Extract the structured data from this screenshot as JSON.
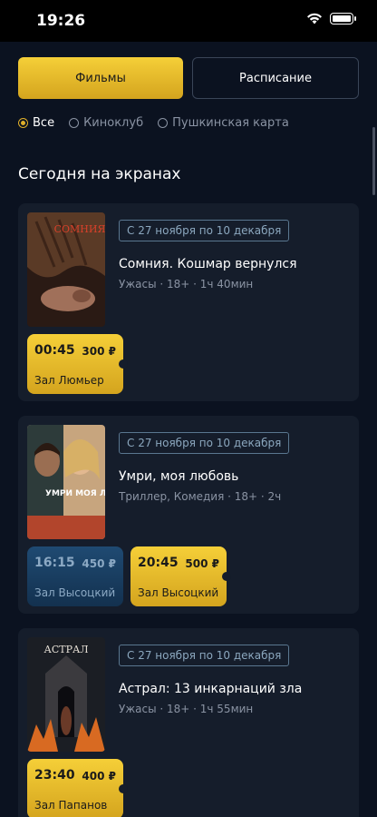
{
  "status_bar": {
    "time": "19:26"
  },
  "tabs": [
    {
      "label": "Фильмы",
      "active": true
    },
    {
      "label": "Расписание",
      "active": false
    }
  ],
  "filters": [
    {
      "label": "Все",
      "selected": true
    },
    {
      "label": "Киноклуб",
      "selected": false
    },
    {
      "label": "Пушкинская карта",
      "selected": false
    }
  ],
  "section_title": "Сегодня на экранах",
  "movies": [
    {
      "date_range": "С 27 ноября по 10 декабря",
      "title": "Сомния. Кошмар вернулся",
      "meta": "Ужасы · 18+ · 1ч 40мин",
      "poster_text": "СОМНИЯ",
      "sessions": [
        {
          "time": "00:45",
          "price": "300 ₽",
          "hall": "Зал Люмьер",
          "style": "gold"
        }
      ]
    },
    {
      "date_range": "С 27 ноября по 10 декабря",
      "title": "Умри, моя любовь",
      "meta": "Триллер, Комедия · 18+ · 2ч",
      "poster_text": "УМРИ МОЯ ЛЮБОВЬ",
      "sessions": [
        {
          "time": "16:15",
          "price": "450 ₽",
          "hall": "Зал Высоцкий",
          "style": "blue"
        },
        {
          "time": "20:45",
          "price": "500 ₽",
          "hall": "Зал Высоцкий",
          "style": "gold"
        }
      ]
    },
    {
      "date_range": "С 27 ноября по 10 декабря",
      "title": "Астрал: 13 инкарнаций зла",
      "meta": "Ужасы · 18+ · 1ч 55мин",
      "poster_text": "АСТРАЛ",
      "sessions": [
        {
          "time": "23:40",
          "price": "400 ₽",
          "hall": "Зал Папанов",
          "style": "gold"
        }
      ]
    }
  ],
  "colors": {
    "background": "#0b1220",
    "card": "#151d2b",
    "accent_gold": "#e0b02a",
    "session_blue": "#1f4a72"
  }
}
